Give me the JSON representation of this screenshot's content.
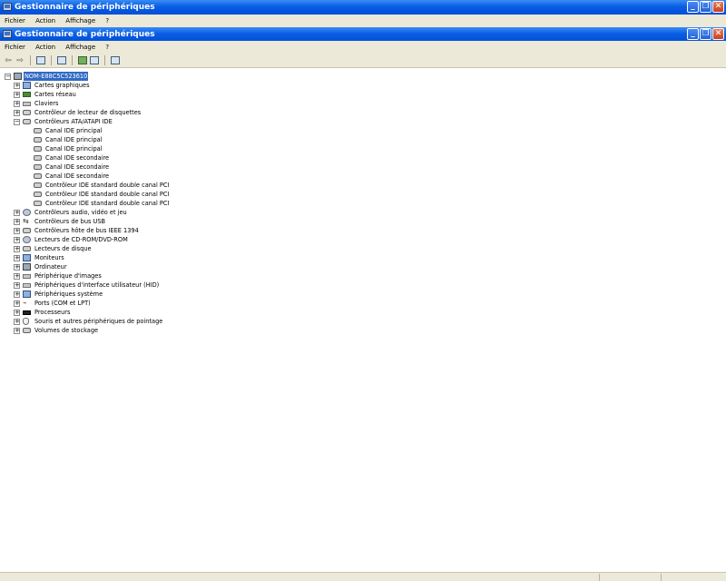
{
  "window": {
    "title": "Gestionnaire de périphériques"
  },
  "menu": {
    "items": [
      "Fichier",
      "Action",
      "Affichage",
      "?"
    ]
  },
  "tree": {
    "root": "NOM-E88C5C523610",
    "categories": [
      {
        "label": "Cartes graphiques",
        "icon": "monitor-icon",
        "expanded": false
      },
      {
        "label": "Cartes réseau",
        "icon": "network-card-icon",
        "expanded": false
      },
      {
        "label": "Claviers",
        "icon": "keyboard-icon",
        "expanded": false
      },
      {
        "label": "Contrôleur de lecteur de disquettes",
        "icon": "floppy-controller-icon",
        "expanded": false
      },
      {
        "label": "Contrôleurs ATA/ATAPI IDE",
        "icon": "ide-controller-icon",
        "expanded": true,
        "children": [
          "Canal IDE principal",
          "Canal IDE principal",
          "Canal IDE principal",
          "Canal IDE secondaire",
          "Canal IDE secondaire",
          "Canal IDE secondaire",
          "Contrôleur IDE standard double canal PCI",
          "Contrôleur IDE standard double canal PCI",
          "Contrôleur IDE standard double canal PCI"
        ]
      },
      {
        "label": "Contrôleurs audio, vidéo et jeu",
        "icon": "audio-icon",
        "expanded": false
      },
      {
        "label": "Contrôleurs de bus USB",
        "icon": "usb-icon",
        "expanded": false
      },
      {
        "label": "Contrôleurs hôte de bus IEEE 1394",
        "icon": "ieee1394-icon",
        "expanded": false
      },
      {
        "label": "Lecteurs de CD-ROM/DVD-ROM",
        "icon": "cdrom-icon",
        "expanded": false
      },
      {
        "label": "Lecteurs de disque",
        "icon": "disk-drive-icon",
        "expanded": false
      },
      {
        "label": "Moniteurs",
        "icon": "monitor-icon",
        "expanded": false
      },
      {
        "label": "Ordinateur",
        "icon": "computer-icon",
        "expanded": false
      },
      {
        "label": "Périphérique d'images",
        "icon": "imaging-device-icon",
        "expanded": false
      },
      {
        "label": "Périphériques d'interface utilisateur (HID)",
        "icon": "hid-icon",
        "expanded": false
      },
      {
        "label": "Périphériques système",
        "icon": "system-device-icon",
        "expanded": false
      },
      {
        "label": "Ports (COM et LPT)",
        "icon": "port-icon",
        "expanded": false
      },
      {
        "label": "Processeurs",
        "icon": "processor-icon",
        "expanded": false
      },
      {
        "label": "Souris et autres périphériques de pointage",
        "icon": "mouse-icon",
        "expanded": false
      },
      {
        "label": "Volumes de stockage",
        "icon": "storage-volume-icon",
        "expanded": false
      }
    ]
  },
  "colors": {
    "titlebar": "#0a5de4",
    "selection": "#316ac5",
    "chrome": "#ece9d8"
  }
}
